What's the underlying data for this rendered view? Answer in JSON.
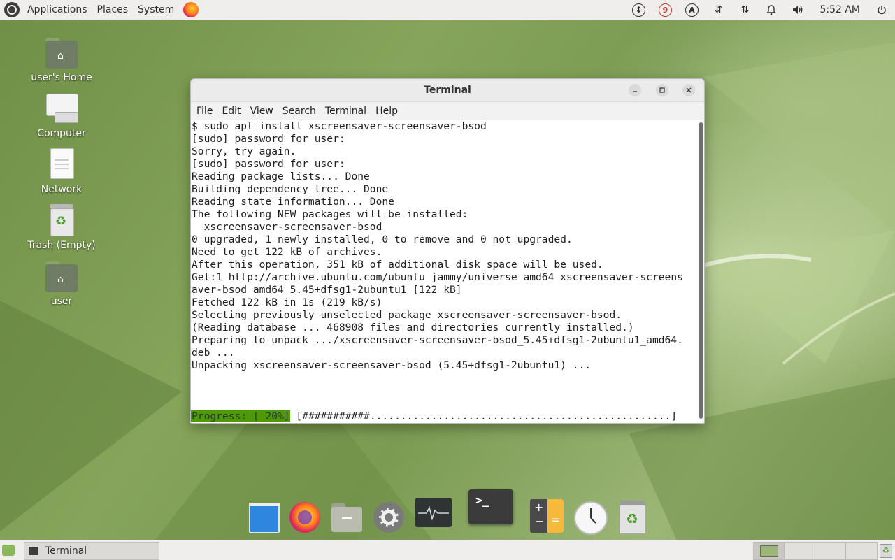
{
  "top_panel": {
    "menus": [
      "Applications",
      "Places",
      "System"
    ],
    "indicator_badge": "9",
    "keyboard_indicator": "A",
    "clock": "5:52 AM"
  },
  "desktop_icons": [
    {
      "label": "user's Home",
      "icon": "home-folder-icon"
    },
    {
      "label": "Computer",
      "icon": "computer-icon"
    },
    {
      "label": "Network",
      "icon": "network-icon"
    },
    {
      "label": "Trash (Empty)",
      "icon": "trash-icon"
    },
    {
      "label": "user",
      "icon": "home-folder-icon"
    }
  ],
  "window": {
    "title": "Terminal",
    "menu": [
      "File",
      "Edit",
      "View",
      "Search",
      "Terminal",
      "Help"
    ],
    "lines": [
      "$ sudo apt install xscreensaver-screensaver-bsod",
      "[sudo] password for user:",
      "Sorry, try again.",
      "[sudo] password for user:",
      "Reading package lists... Done",
      "Building dependency tree... Done",
      "Reading state information... Done",
      "The following NEW packages will be installed:",
      "  xscreensaver-screensaver-bsod",
      "0 upgraded, 1 newly installed, 0 to remove and 0 not upgraded.",
      "Need to get 122 kB of archives.",
      "After this operation, 351 kB of additional disk space will be used.",
      "Get:1 http://archive.ubuntu.com/ubuntu jammy/universe amd64 xscreensaver-screens",
      "aver-bsod amd64 5.45+dfsg1-2ubuntu1 [122 kB]",
      "Fetched 122 kB in 1s (219 kB/s)",
      "Selecting previously unselected package xscreensaver-screensaver-bsod.",
      "(Reading database ... 468908 files and directories currently installed.)",
      "Preparing to unpack .../xscreensaver-screensaver-bsod_5.45+dfsg1-2ubuntu1_amd64.",
      "deb ...",
      "Unpacking xscreensaver-screensaver-bsod (5.45+dfsg1-2ubuntu1) ..."
    ],
    "progress_label": "Progress: [ 20%]",
    "progress_bar": " [###########.................................................]",
    "progress_percent": 20
  },
  "taskbar": {
    "task_label": "Terminal"
  },
  "colors": {
    "progress_green": "#4e9a06",
    "wallpaper_green": "#7b9b52"
  }
}
